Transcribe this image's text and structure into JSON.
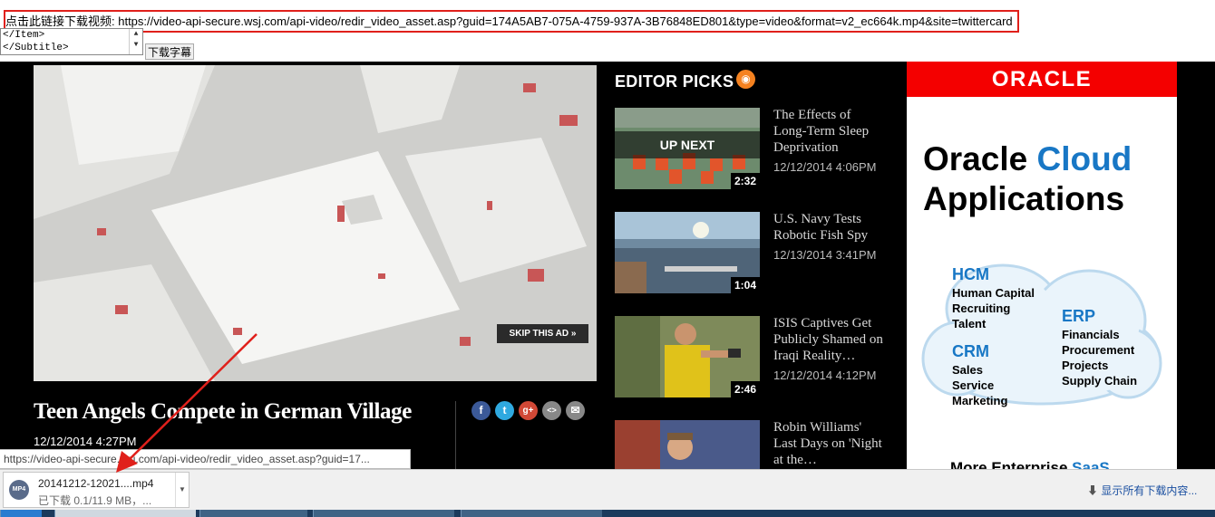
{
  "top": {
    "download_link": "点击此链接下载视频: https://video-api-secure.wsj.com/api-video/redir_video_asset.asp?guid=174A5AB7-075A-4759-937A-3B76848ED801&type=video&format=v2_ec664k.mp4&site=twittercard",
    "subtitle_line1": "</Item>",
    "subtitle_line2": "</Subtitle>",
    "subtitle_button": "下载字幕"
  },
  "video": {
    "skip_ad": "SKIP THIS AD »",
    "title": "Teen Angels Compete in German Village",
    "date": "12/12/2014 4:27PM",
    "share": [
      "f",
      "t",
      "g+",
      "<>",
      "✉"
    ]
  },
  "editor_picks": {
    "title": "EDITOR PICKS",
    "rss_icon": "rss-icon",
    "up_next": "UP NEXT",
    "items": [
      {
        "title": "The Effects of Long-Term Sleep Deprivation",
        "date": "12/12/2014 4:06PM",
        "duration": "2:32"
      },
      {
        "title": "U.S. Navy Tests Robotic Fish Spy",
        "date": "12/13/2014 3:41PM",
        "duration": "1:04"
      },
      {
        "title": "ISIS Captives Get Publicly Shamed on Iraqi Reality…",
        "date": "12/12/2014 4:12PM",
        "duration": "2:46"
      },
      {
        "title": "Robin Williams' Last Days on 'Night at the…",
        "date": "",
        "duration": ""
      }
    ]
  },
  "ad": {
    "brand": "ORACLE",
    "headline_part1": "Oracle ",
    "headline_part2": "Cloud",
    "headline_line2": "Applications",
    "hcm": "HCM",
    "hcm_items": [
      "Human Capital",
      "Recruiting",
      "Talent"
    ],
    "erp": "ERP",
    "erp_items": [
      "Financials",
      "Procurement",
      "Projects",
      "Supply Chain"
    ],
    "crm": "CRM",
    "crm_items": [
      "Sales",
      "Service",
      "Marketing"
    ],
    "more_part1": "More Enterprise ",
    "more_part2": "SaaS",
    "colors": {
      "brand_red": "#f40000",
      "brand_blue": "#1877c5"
    }
  },
  "browser": {
    "status_url": "https://video-api-secure.wsj.com/api-video/redir_video_asset.asp?guid=17...",
    "download_name": "20141212-12021....mp4",
    "download_status": "已下载 0.1/11.9 MB，...",
    "download_icon": "mp4-file-icon",
    "show_all": "显示所有下载内容..."
  }
}
